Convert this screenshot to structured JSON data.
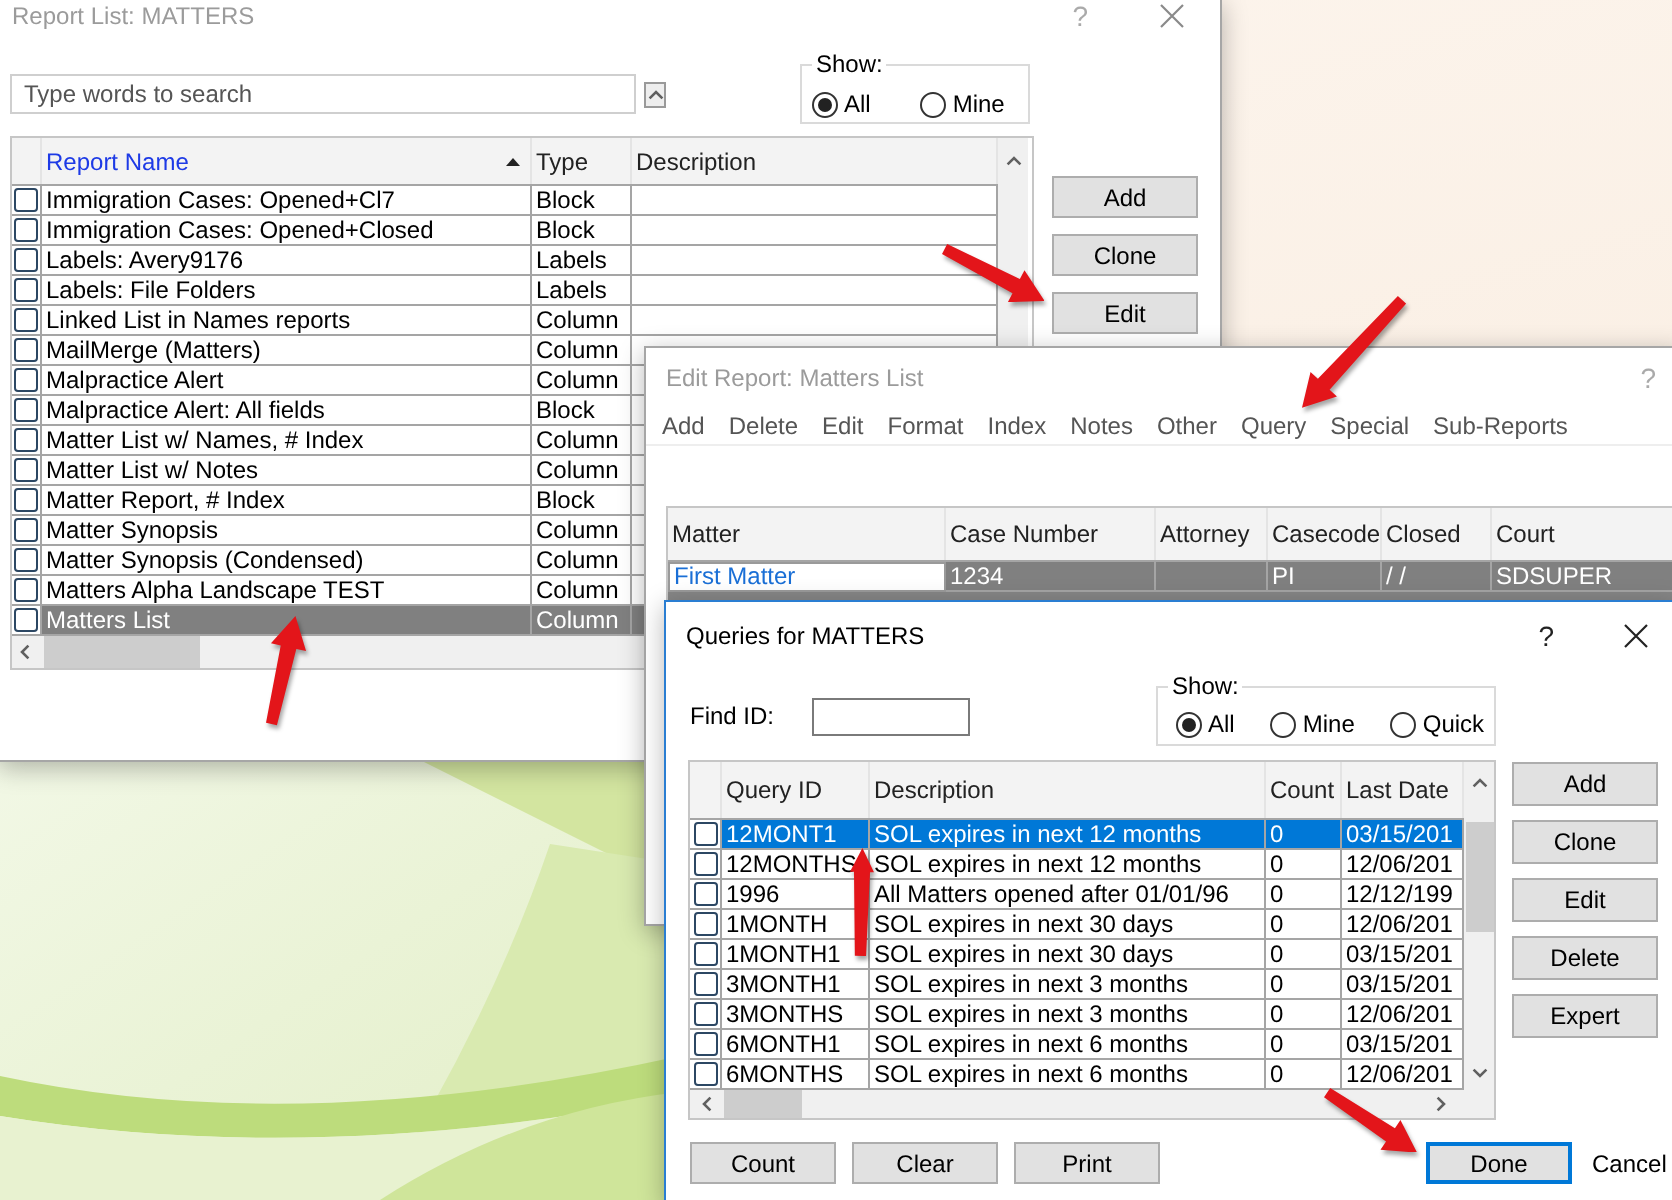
{
  "report_list": {
    "title": "Report List: MATTERS",
    "active": false,
    "help": "?",
    "search": {
      "placeholder": "Type words to search"
    },
    "show": {
      "label": "Show:",
      "options": [
        {
          "label": "All",
          "selected": true
        },
        {
          "label": "Mine",
          "selected": false
        }
      ]
    },
    "table": {
      "columns": [
        {
          "label": "Report Name",
          "sorted": true
        },
        {
          "label": "Type",
          "sorted": false
        },
        {
          "label": "Description",
          "sorted": false
        }
      ],
      "rows": [
        {
          "name": "Immigration Cases: Opened+Cl7",
          "type": "Block",
          "checked": false,
          "selected": false
        },
        {
          "name": "Immigration Cases: Opened+Closed",
          "type": "Block",
          "checked": false,
          "selected": false
        },
        {
          "name": "Labels: Avery9176",
          "type": "Labels",
          "checked": false,
          "selected": false
        },
        {
          "name": "Labels: File Folders",
          "type": "Labels",
          "checked": false,
          "selected": false
        },
        {
          "name": "Linked List in Names reports",
          "type": "Column",
          "checked": false,
          "selected": false
        },
        {
          "name": "MailMerge (Matters)",
          "type": "Column",
          "checked": false,
          "selected": false
        },
        {
          "name": "Malpractice Alert",
          "type": "Column",
          "checked": false,
          "selected": false
        },
        {
          "name": "Malpractice Alert: All fields",
          "type": "Block",
          "checked": false,
          "selected": false
        },
        {
          "name": "Matter List w/ Names, # Index",
          "type": "Column",
          "checked": false,
          "selected": false
        },
        {
          "name": "Matter List w/ Notes",
          "type": "Column",
          "checked": false,
          "selected": false
        },
        {
          "name": "Matter Report, # Index",
          "type": "Block",
          "checked": false,
          "selected": false
        },
        {
          "name": "Matter Synopsis",
          "type": "Column",
          "checked": false,
          "selected": false
        },
        {
          "name": "Matter Synopsis (Condensed)",
          "type": "Column",
          "checked": false,
          "selected": false
        },
        {
          "name": "Matters Alpha Landscape TEST",
          "type": "Column",
          "checked": false,
          "selected": false
        },
        {
          "name": "Matters List",
          "type": "Column",
          "checked": false,
          "selected": true
        }
      ]
    },
    "buttons": [
      "Add",
      "Clone",
      "Edit"
    ]
  },
  "edit_report": {
    "title": "Edit Report: Matters List",
    "active": false,
    "help": "?",
    "menu": [
      "Add",
      "Delete",
      "Edit",
      "Format",
      "Index",
      "Notes",
      "Other",
      "Query",
      "Special",
      "Sub-Reports"
    ],
    "table": {
      "columns": [
        "Matter",
        "Case Number",
        "Attorney",
        "Casecode",
        "Closed",
        "Court"
      ],
      "rows": [
        {
          "cells": [
            "First Matter",
            "1234",
            null,
            "PI",
            "/ /",
            "SDSUPER"
          ],
          "selected": true
        }
      ]
    }
  },
  "queries": {
    "title": "Queries for MATTERS",
    "active": true,
    "help": "?",
    "find": {
      "label": "Find ID:"
    },
    "show": {
      "label": "Show:",
      "options": [
        {
          "label": "All",
          "selected": true
        },
        {
          "label": "Mine",
          "selected": false
        },
        {
          "label": "Quick",
          "selected": false
        }
      ]
    },
    "table": {
      "columns": [
        "Query ID",
        "Description",
        "Count",
        "Last Date"
      ],
      "rows": [
        {
          "query_id": "12MONT1",
          "description": "SOL expires in next 12 months",
          "count": "0",
          "last_date": "03/15/201",
          "checked": false,
          "selected": true
        },
        {
          "query_id": "12MONTHS",
          "description": "SOL expires in next 12 months",
          "count": "0",
          "last_date": "12/06/201",
          "checked": false,
          "selected": false
        },
        {
          "query_id": "1996",
          "description": "All Matters opened after 01/01/96",
          "count": "0",
          "last_date": "12/12/199",
          "checked": false,
          "selected": false
        },
        {
          "query_id": "1MONTH",
          "description": "SOL expires in next 30 days",
          "count": "0",
          "last_date": "12/06/201",
          "checked": false,
          "selected": false
        },
        {
          "query_id": "1MONTH1",
          "description": "SOL expires in next 30 days",
          "count": "0",
          "last_date": "03/15/201",
          "checked": false,
          "selected": false
        },
        {
          "query_id": "3MONTH1",
          "description": "SOL expires in next 3 months",
          "count": "0",
          "last_date": "03/15/201",
          "checked": false,
          "selected": false
        },
        {
          "query_id": "3MONTHS",
          "description": "SOL expires in next 3 months",
          "count": "0",
          "last_date": "12/06/201",
          "checked": false,
          "selected": false
        },
        {
          "query_id": "6MONTH1",
          "description": "SOL expires in next 6 months",
          "count": "0",
          "last_date": "03/15/201",
          "checked": false,
          "selected": false
        },
        {
          "query_id": "6MONTHS",
          "description": "SOL expires in next 6 months",
          "count": "0",
          "last_date": "12/06/201",
          "checked": false,
          "selected": false
        }
      ]
    },
    "side_buttons": [
      "Add",
      "Clone",
      "Edit",
      "Delete",
      "Expert"
    ],
    "bottom_buttons": [
      {
        "label": "Count",
        "kind": "normal"
      },
      {
        "label": "Clear",
        "kind": "normal"
      },
      {
        "label": "Print",
        "kind": "normal"
      },
      {
        "label": "Done",
        "kind": "default"
      },
      {
        "label": "Cancel",
        "kind": "flat"
      }
    ]
  }
}
